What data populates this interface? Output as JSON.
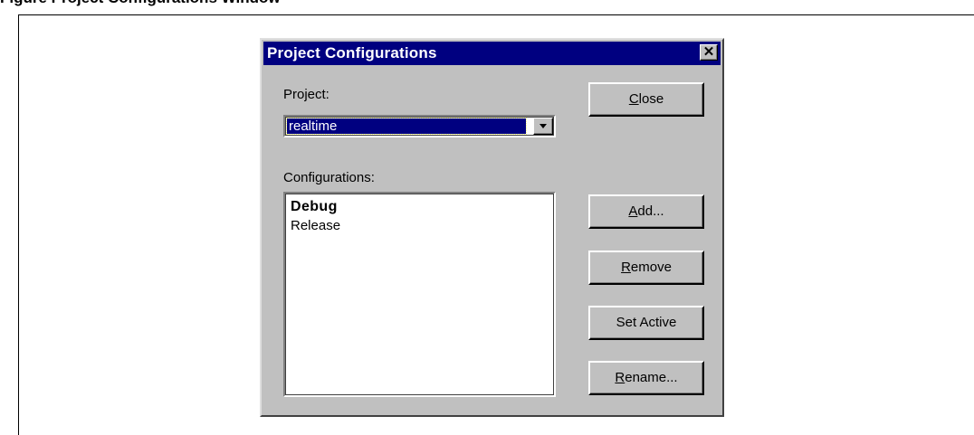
{
  "document": {
    "caption": "Figure       Project Configurations Window"
  },
  "dialog": {
    "title": "Project Configurations",
    "close_glyph": "✕",
    "project_label": "Project:",
    "project_selected": "realtime",
    "configurations_label": "Configurations:",
    "configurations": [
      {
        "label": "Debug",
        "active": true
      },
      {
        "label": "Release",
        "active": false
      }
    ],
    "buttons": {
      "close": {
        "mnemonic": "C",
        "rest": "lose"
      },
      "add": {
        "mnemonic": "A",
        "rest": "dd..."
      },
      "remove": {
        "mnemonic": "R",
        "rest": "emove"
      },
      "set_active": {
        "label": "Set Active"
      },
      "rename": {
        "mnemonic": "R",
        "rest": "ename..."
      }
    }
  },
  "colors": {
    "titlebar": "#000080",
    "dialog_face": "#c0c0c0",
    "selection": "#000080"
  }
}
